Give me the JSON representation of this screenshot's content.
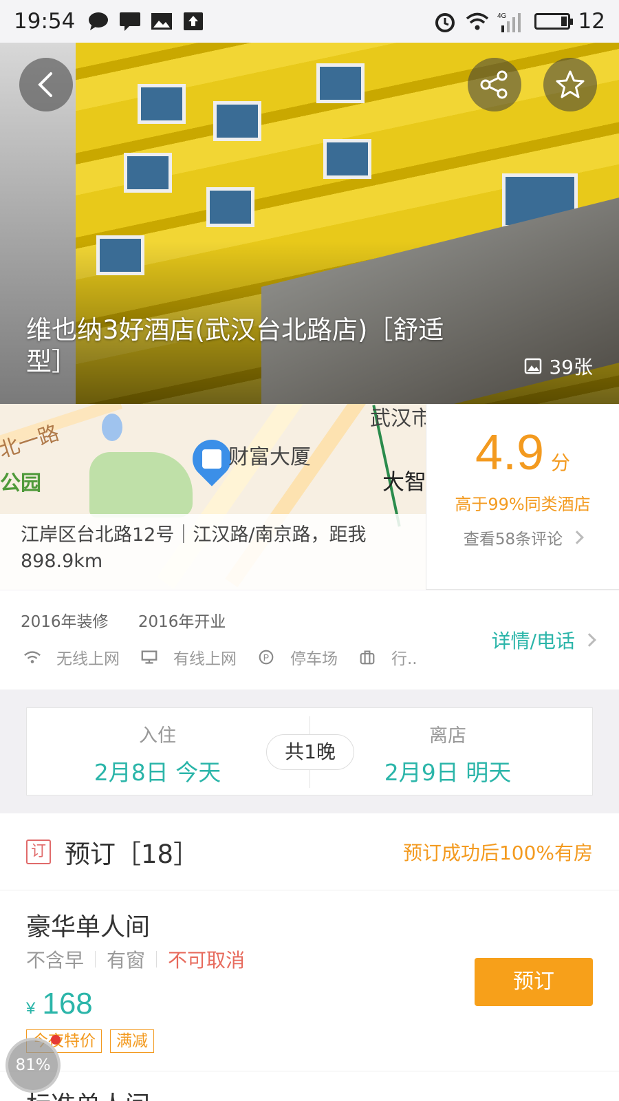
{
  "status_bar": {
    "time": "19:54",
    "network": "4G",
    "battery": "12"
  },
  "hero": {
    "title": "维也纳3好酒店(武汉台北路店)［舒适型］",
    "photo_count": "39张"
  },
  "map": {
    "labels": [
      "北一路",
      "公园",
      "财富大厦",
      "武汉市",
      "大智"
    ],
    "address": "江岸区台北路12号｜江汉路/南京路，距我898.9km"
  },
  "rating": {
    "score": "4.9",
    "unit": "分",
    "rank": "高于99%同类酒店",
    "reviews": "查看58条评论"
  },
  "facilities": {
    "renovated": "2016年装修",
    "opened": "2016年开业",
    "items": [
      "无线上网",
      "有线上网",
      "停车场",
      "行.."
    ],
    "detail_link": "详情/电话"
  },
  "dates": {
    "checkin_label": "入住",
    "checkin_value": "2月8日  今天",
    "nights": "共1晚",
    "checkout_label": "离店",
    "checkout_value": "2月9日  明天"
  },
  "booking": {
    "icon": "订",
    "title": "预订［18］",
    "guarantee": "预订成功后100%有房"
  },
  "rooms": [
    {
      "name": "豪华单人间",
      "tags": [
        "不含早",
        "有窗",
        "不可取消"
      ],
      "currency": "¥",
      "price": "168",
      "promos": [
        "今夜特价",
        "满减"
      ],
      "book_label": "预订"
    },
    {
      "name": "标准单人间"
    }
  ],
  "float_badge": "81%",
  "colors": {
    "accent": "#2bb5a9",
    "orange": "#f39a1f",
    "red": "#e76a5c"
  }
}
